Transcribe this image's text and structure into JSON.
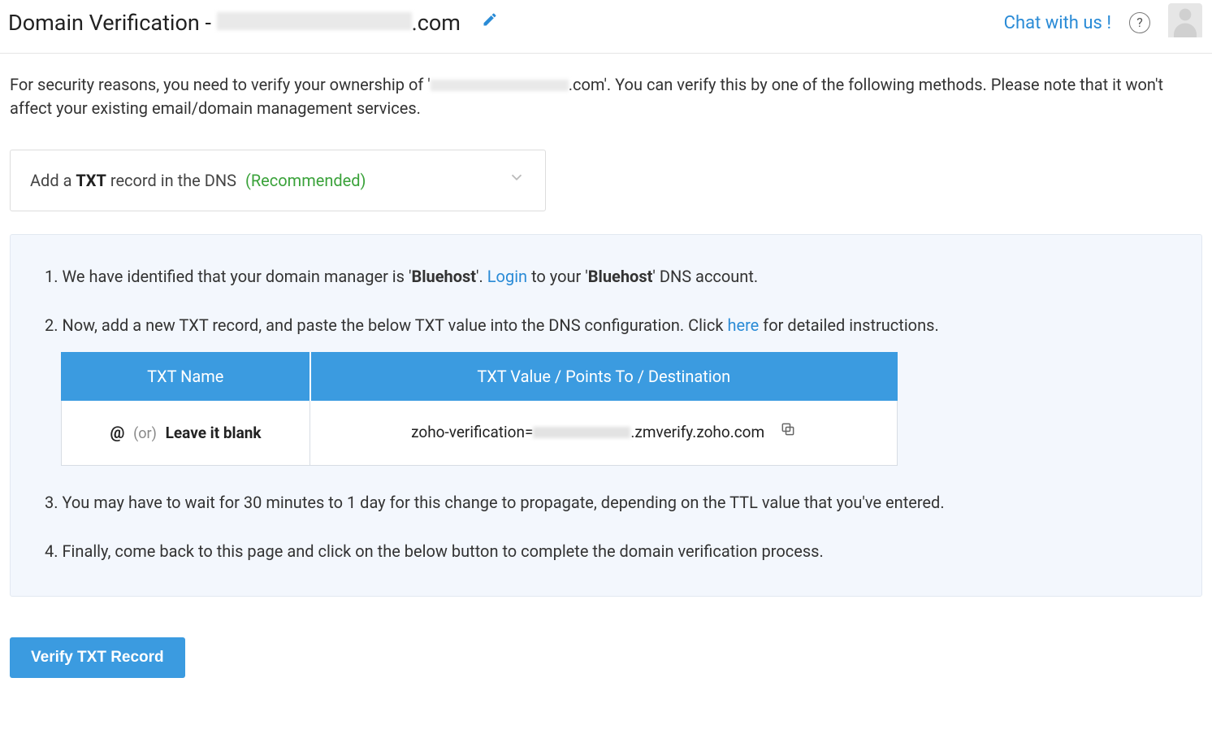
{
  "header": {
    "title_prefix": "Domain Verification - ",
    "title_suffix": ".com",
    "chat_label": "Chat with us !",
    "help_glyph": "?"
  },
  "intro": {
    "prefix": "For security reasons, you need to verify your ownership of '",
    "suffix": ".com'. You can verify this by one of the following methods. Please note that it won't affect your existing email/domain management services."
  },
  "method": {
    "pre": "Add a ",
    "bold": "TXT",
    "post": " record in the DNS",
    "recommended": "(Recommended)"
  },
  "steps": {
    "s1_pre": "1. We have identified that your domain manager is '",
    "s1_provider": "Bluehost",
    "s1_mid": "'. ",
    "s1_login": "Login",
    "s1_mid2": " to your '",
    "s1_provider2": "Bluehost",
    "s1_post": "' DNS account.",
    "s2_pre": "2. Now, add a new TXT record, and paste the below TXT value into the DNS configuration. Click ",
    "s2_here": "here",
    "s2_post": " for detailed instructions.",
    "s3": "3. You may have to wait for 30 minutes to 1 day for this change to propagate, depending on the TTL value that you've entered.",
    "s4": "4. Finally, come back to this page and click on the below button to complete the domain verification process."
  },
  "table": {
    "th_name": "TXT Name",
    "th_value": "TXT Value / Points To / Destination",
    "at": "@",
    "or": "(or)",
    "blank": "Leave it blank",
    "val_prefix": "zoho-verification=",
    "val_suffix": ".zmverify.zoho.com"
  },
  "button": {
    "verify": "Verify TXT Record"
  }
}
